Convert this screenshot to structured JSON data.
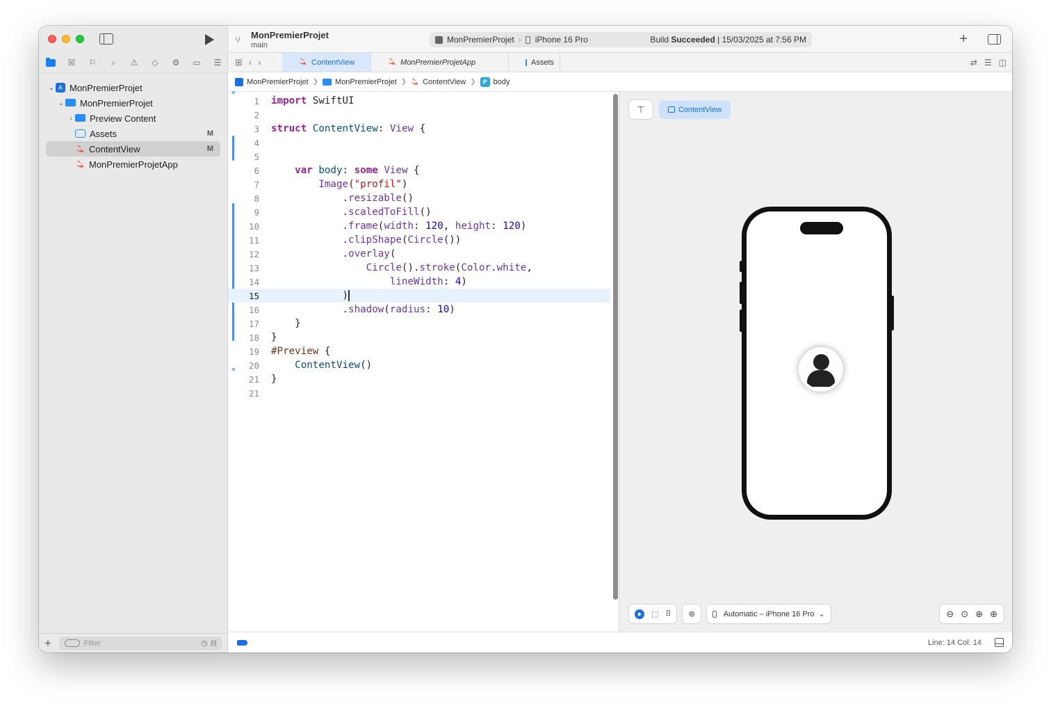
{
  "window": {
    "project_name": "MonPremierProjet",
    "branch": "main"
  },
  "activity": {
    "scheme": "MonPremierProjet",
    "device": "iPhone 16 Pro",
    "status_prefix": "Build ",
    "status_bold": "Succeeded",
    "status_suffix": " | 15/03/2025 at 7:56 PM"
  },
  "navigator": {
    "tree": [
      {
        "label": "MonPremierProjet",
        "badge": ""
      },
      {
        "label": "MonPremierProjet",
        "badge": ""
      },
      {
        "label": "Preview Content",
        "badge": ""
      },
      {
        "label": "Assets",
        "badge": "M"
      },
      {
        "label": "ContentView",
        "badge": "M"
      },
      {
        "label": "MonPremierProjetApp",
        "badge": ""
      }
    ],
    "filter_placeholder": "Filter"
  },
  "tabs": [
    {
      "label": "ContentView"
    },
    {
      "label": "MonPremierProjetApp"
    },
    {
      "label": "Assets"
    }
  ],
  "breadcrumb": [
    "MonPremierProjet",
    "MonPremierProjet",
    "ContentView",
    "body"
  ],
  "breadcrumb_symbol": "P",
  "editor": {
    "current_line": 14,
    "lines": [
      "import SwiftUI",
      "",
      "struct ContentView: View {",
      "",
      "",
      "    var body: some View {",
      "        Image(\"profil\")",
      "            .resizable()",
      "            .scaledToFill()",
      "            .frame(width: 120, height: 120)",
      "            .clipShape(Circle())",
      "            .overlay(",
      "                Circle().stroke(Color.white,",
      "                    lineWidth: 4)",
      "            )",
      "            .shadow(radius: 10)",
      "    }",
      "}",
      "#Preview {",
      "    ContentView()",
      "}"
    ],
    "line_numbers": [
      "1",
      "2",
      "3",
      "4",
      "5",
      "6",
      "7",
      "8",
      "9",
      "10",
      "11",
      "12",
      "13",
      "14",
      "15",
      "16",
      "17",
      "18",
      "19",
      "20",
      "21"
    ]
  },
  "canvas": {
    "preview_tab": "ContentView",
    "device_selector": "Automatic – iPhone 16 Pro"
  },
  "statusbar": {
    "position": "Line: 14  Col: 14"
  },
  "colors": {
    "accent": "#1a6fe0",
    "keyword": "#9b2393",
    "type": "#0b4f79",
    "function": "#6c36a9",
    "string": "#c41a16",
    "number": "#1c00cf"
  }
}
